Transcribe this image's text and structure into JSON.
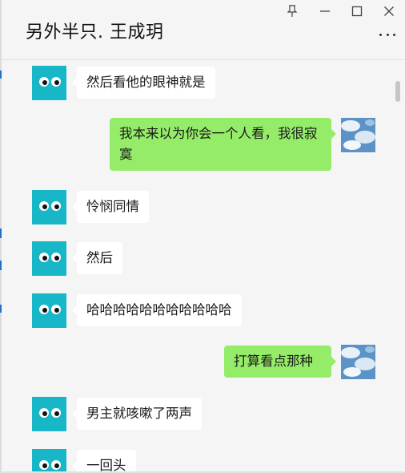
{
  "window": {
    "title": "另外半只. 王成玥"
  },
  "messages": [
    {
      "from": "other",
      "text": "然后看他的眼神就是"
    },
    {
      "from": "self",
      "text": "我本来以为你会一个人看，我很寂寞"
    },
    {
      "from": "other",
      "text": "怜悯同情"
    },
    {
      "from": "other",
      "text": "然后"
    },
    {
      "from": "other",
      "text": "哈哈哈哈哈哈哈哈哈哈哈"
    },
    {
      "from": "self",
      "text": "打算看点那种"
    },
    {
      "from": "other",
      "text": "男主就咳嗽了两声"
    },
    {
      "from": "other",
      "text": "一回头"
    }
  ],
  "colors": {
    "self_bubble": "#95ec69",
    "other_bubble": "#ffffff",
    "other_avatar": "#18b7c8"
  },
  "icons": {
    "pin": "pin-icon",
    "minimize": "minimize-icon",
    "maximize": "maximize-icon",
    "close": "close-icon",
    "more": "more-icon"
  }
}
